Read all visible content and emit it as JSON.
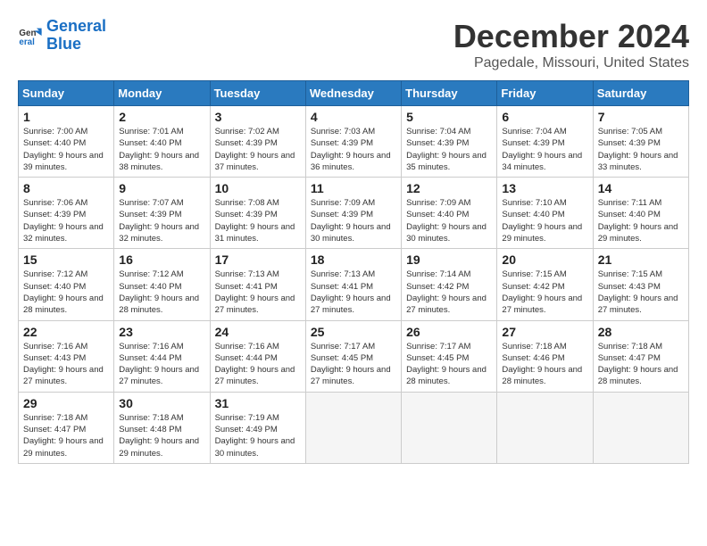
{
  "logo": {
    "line1": "General",
    "line2": "Blue"
  },
  "title": "December 2024",
  "location": "Pagedale, Missouri, United States",
  "weekdays": [
    "Sunday",
    "Monday",
    "Tuesday",
    "Wednesday",
    "Thursday",
    "Friday",
    "Saturday"
  ],
  "weeks": [
    [
      {
        "day": "1",
        "sunrise": "Sunrise: 7:00 AM",
        "sunset": "Sunset: 4:40 PM",
        "daylight": "Daylight: 9 hours and 39 minutes."
      },
      {
        "day": "2",
        "sunrise": "Sunrise: 7:01 AM",
        "sunset": "Sunset: 4:40 PM",
        "daylight": "Daylight: 9 hours and 38 minutes."
      },
      {
        "day": "3",
        "sunrise": "Sunrise: 7:02 AM",
        "sunset": "Sunset: 4:39 PM",
        "daylight": "Daylight: 9 hours and 37 minutes."
      },
      {
        "day": "4",
        "sunrise": "Sunrise: 7:03 AM",
        "sunset": "Sunset: 4:39 PM",
        "daylight": "Daylight: 9 hours and 36 minutes."
      },
      {
        "day": "5",
        "sunrise": "Sunrise: 7:04 AM",
        "sunset": "Sunset: 4:39 PM",
        "daylight": "Daylight: 9 hours and 35 minutes."
      },
      {
        "day": "6",
        "sunrise": "Sunrise: 7:04 AM",
        "sunset": "Sunset: 4:39 PM",
        "daylight": "Daylight: 9 hours and 34 minutes."
      },
      {
        "day": "7",
        "sunrise": "Sunrise: 7:05 AM",
        "sunset": "Sunset: 4:39 PM",
        "daylight": "Daylight: 9 hours and 33 minutes."
      }
    ],
    [
      {
        "day": "8",
        "sunrise": "Sunrise: 7:06 AM",
        "sunset": "Sunset: 4:39 PM",
        "daylight": "Daylight: 9 hours and 32 minutes."
      },
      {
        "day": "9",
        "sunrise": "Sunrise: 7:07 AM",
        "sunset": "Sunset: 4:39 PM",
        "daylight": "Daylight: 9 hours and 32 minutes."
      },
      {
        "day": "10",
        "sunrise": "Sunrise: 7:08 AM",
        "sunset": "Sunset: 4:39 PM",
        "daylight": "Daylight: 9 hours and 31 minutes."
      },
      {
        "day": "11",
        "sunrise": "Sunrise: 7:09 AM",
        "sunset": "Sunset: 4:39 PM",
        "daylight": "Daylight: 9 hours and 30 minutes."
      },
      {
        "day": "12",
        "sunrise": "Sunrise: 7:09 AM",
        "sunset": "Sunset: 4:40 PM",
        "daylight": "Daylight: 9 hours and 30 minutes."
      },
      {
        "day": "13",
        "sunrise": "Sunrise: 7:10 AM",
        "sunset": "Sunset: 4:40 PM",
        "daylight": "Daylight: 9 hours and 29 minutes."
      },
      {
        "day": "14",
        "sunrise": "Sunrise: 7:11 AM",
        "sunset": "Sunset: 4:40 PM",
        "daylight": "Daylight: 9 hours and 29 minutes."
      }
    ],
    [
      {
        "day": "15",
        "sunrise": "Sunrise: 7:12 AM",
        "sunset": "Sunset: 4:40 PM",
        "daylight": "Daylight: 9 hours and 28 minutes."
      },
      {
        "day": "16",
        "sunrise": "Sunrise: 7:12 AM",
        "sunset": "Sunset: 4:40 PM",
        "daylight": "Daylight: 9 hours and 28 minutes."
      },
      {
        "day": "17",
        "sunrise": "Sunrise: 7:13 AM",
        "sunset": "Sunset: 4:41 PM",
        "daylight": "Daylight: 9 hours and 27 minutes."
      },
      {
        "day": "18",
        "sunrise": "Sunrise: 7:13 AM",
        "sunset": "Sunset: 4:41 PM",
        "daylight": "Daylight: 9 hours and 27 minutes."
      },
      {
        "day": "19",
        "sunrise": "Sunrise: 7:14 AM",
        "sunset": "Sunset: 4:42 PM",
        "daylight": "Daylight: 9 hours and 27 minutes."
      },
      {
        "day": "20",
        "sunrise": "Sunrise: 7:15 AM",
        "sunset": "Sunset: 4:42 PM",
        "daylight": "Daylight: 9 hours and 27 minutes."
      },
      {
        "day": "21",
        "sunrise": "Sunrise: 7:15 AM",
        "sunset": "Sunset: 4:43 PM",
        "daylight": "Daylight: 9 hours and 27 minutes."
      }
    ],
    [
      {
        "day": "22",
        "sunrise": "Sunrise: 7:16 AM",
        "sunset": "Sunset: 4:43 PM",
        "daylight": "Daylight: 9 hours and 27 minutes."
      },
      {
        "day": "23",
        "sunrise": "Sunrise: 7:16 AM",
        "sunset": "Sunset: 4:44 PM",
        "daylight": "Daylight: 9 hours and 27 minutes."
      },
      {
        "day": "24",
        "sunrise": "Sunrise: 7:16 AM",
        "sunset": "Sunset: 4:44 PM",
        "daylight": "Daylight: 9 hours and 27 minutes."
      },
      {
        "day": "25",
        "sunrise": "Sunrise: 7:17 AM",
        "sunset": "Sunset: 4:45 PM",
        "daylight": "Daylight: 9 hours and 27 minutes."
      },
      {
        "day": "26",
        "sunrise": "Sunrise: 7:17 AM",
        "sunset": "Sunset: 4:45 PM",
        "daylight": "Daylight: 9 hours and 28 minutes."
      },
      {
        "day": "27",
        "sunrise": "Sunrise: 7:18 AM",
        "sunset": "Sunset: 4:46 PM",
        "daylight": "Daylight: 9 hours and 28 minutes."
      },
      {
        "day": "28",
        "sunrise": "Sunrise: 7:18 AM",
        "sunset": "Sunset: 4:47 PM",
        "daylight": "Daylight: 9 hours and 28 minutes."
      }
    ],
    [
      {
        "day": "29",
        "sunrise": "Sunrise: 7:18 AM",
        "sunset": "Sunset: 4:47 PM",
        "daylight": "Daylight: 9 hours and 29 minutes."
      },
      {
        "day": "30",
        "sunrise": "Sunrise: 7:18 AM",
        "sunset": "Sunset: 4:48 PM",
        "daylight": "Daylight: 9 hours and 29 minutes."
      },
      {
        "day": "31",
        "sunrise": "Sunrise: 7:19 AM",
        "sunset": "Sunset: 4:49 PM",
        "daylight": "Daylight: 9 hours and 30 minutes."
      },
      null,
      null,
      null,
      null
    ]
  ]
}
